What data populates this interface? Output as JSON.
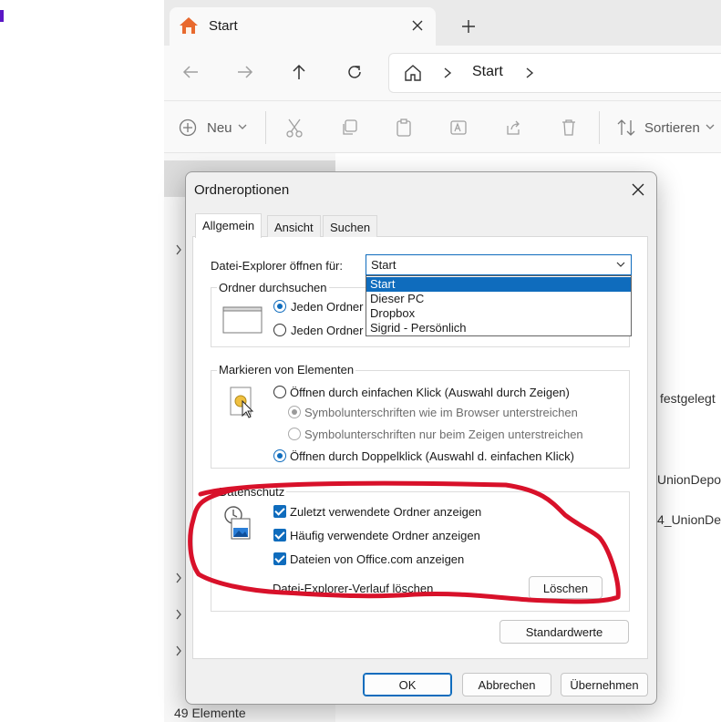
{
  "explorer": {
    "tab_title": "Start",
    "breadcrumb": "Start",
    "toolbar": {
      "new_label": "Neu",
      "sort_label": "Sortieren"
    },
    "content_snippets": [
      "festgelegt",
      "UnionDepo",
      "4_UnionDe"
    ],
    "status_text": "49 Elemente"
  },
  "dialog": {
    "title": "Ordneroptionen",
    "tabs": [
      {
        "label": "Allgemein",
        "active": true
      },
      {
        "label": "Ansicht",
        "active": false
      },
      {
        "label": "Suchen",
        "active": false
      }
    ],
    "open_for": {
      "label": "Datei-Explorer öffnen für:",
      "value": "Start",
      "options": [
        "Start",
        "Dieser PC",
        "Dropbox",
        "Sigrid - Persönlich"
      ]
    },
    "browse_group": {
      "title": "Ordner durchsuchen",
      "options": [
        "Jeden Ordner",
        "Jeden Ordner"
      ]
    },
    "click_group": {
      "title": "Markieren von Elementen",
      "single_click": "Öffnen durch einfachen Klick (Auswahl durch Zeigen)",
      "underline_browser": "Symbolunterschriften wie im Browser unterstreichen",
      "underline_hover": "Symbolunterschriften nur beim Zeigen unterstreichen",
      "double_click": "Öffnen durch Doppelklick (Auswahl d. einfachen Klick)"
    },
    "privacy_group": {
      "title": "Datenschutz",
      "recent_folders": "Zuletzt verwendete Ordner anzeigen",
      "frequent_folders": "Häufig verwendete Ordner anzeigen",
      "office_files": "Dateien von Office.com anzeigen",
      "clear_history_label": "Datei-Explorer-Verlauf löschen",
      "clear_button": "Löschen"
    },
    "defaults_button": "Standardwerte",
    "ok_button": "OK",
    "cancel_button": "Abbrechen",
    "apply_button": "Übernehmen"
  },
  "colors": {
    "accent": "#0f6cbd",
    "annotation": "#d8112a",
    "home_icon": "#e8692e"
  }
}
